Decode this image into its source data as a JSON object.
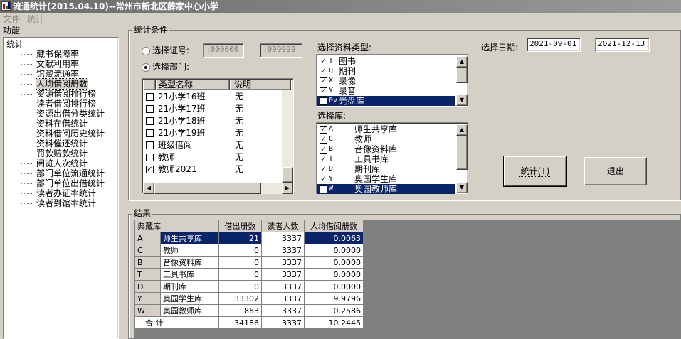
{
  "window": {
    "title": "流通统计(2015.04.10)--常州市新北区薛家中心小学"
  },
  "menu": [
    {
      "label": "文件"
    },
    {
      "label": "统计"
    }
  ],
  "function_panel": {
    "title": "功能",
    "root": "统计",
    "items": [
      "藏书保障率",
      "文献利用率",
      "馆藏流通率",
      "人均借阅册数",
      "资源借阅排行榜",
      "读者借阅排行榜",
      "资源出借分类统计",
      "资料在借统计",
      "资料借阅历史统计",
      "资料催还统计",
      "罚款赔款统计",
      "阅览人次统计",
      "部门单位流通统计",
      "部门单位出借统计",
      "读者办证率统计",
      "读者到馆率统计"
    ],
    "selected_index": 3
  },
  "criteria": {
    "title": "统计条件",
    "radio_card": "选择证号:",
    "card_from": "j000000",
    "card_to": "j999999",
    "dash": "—",
    "radio_dept": "选择部门:",
    "dept_columns": [
      "类型名称",
      "说明"
    ],
    "dept_rows": [
      {
        "name": "21小学16班",
        "desc": "无",
        "checked": false
      },
      {
        "name": "21小学17班",
        "desc": "无",
        "checked": false
      },
      {
        "name": "21小学18班",
        "desc": "无",
        "checked": false
      },
      {
        "name": "21小学19班",
        "desc": "无",
        "checked": false
      },
      {
        "name": "班级借阅",
        "desc": "无",
        "checked": false
      },
      {
        "name": "教师",
        "desc": "无",
        "checked": false
      },
      {
        "name": "教师2021",
        "desc": "无",
        "checked": true
      }
    ],
    "type_label": "选择资料类型:",
    "types": [
      {
        "code": "T",
        "name": "图书",
        "checked": true
      },
      {
        "code": "Q",
        "name": "期刊",
        "checked": true
      },
      {
        "code": "X",
        "name": "录像",
        "checked": true
      },
      {
        "code": "Y",
        "name": "录音",
        "checked": true
      },
      {
        "code": "0v",
        "name": "光盘库",
        "checked": true,
        "selected": true
      }
    ],
    "lib_label": "选择库:",
    "libs": [
      {
        "code": "A",
        "name": "师生共享库",
        "checked": true
      },
      {
        "code": "C",
        "name": "教师",
        "checked": true
      },
      {
        "code": "B",
        "name": "音像资料库",
        "checked": true
      },
      {
        "code": "T",
        "name": "工具书库",
        "checked": true
      },
      {
        "code": "D",
        "name": "期刊库",
        "checked": true
      },
      {
        "code": "Y",
        "name": "奥园学生库",
        "checked": true
      },
      {
        "code": "W",
        "name": "奥园教师库",
        "checked": true,
        "selected": true
      }
    ],
    "date_label": "选择日期:",
    "date_from": "2021-09-01",
    "date_to": "2021-12-13",
    "btn_stat": "统计(T)",
    "btn_exit": "退出"
  },
  "results": {
    "title": "结果",
    "columns": [
      "典藏库",
      "借出册数",
      "读者人数",
      "人均借阅册数"
    ],
    "rows": [
      {
        "code": "A",
        "name": "师生共享库",
        "lent": "21",
        "readers": "3337",
        "avg": "0.0063",
        "selected": true
      },
      {
        "code": "C",
        "name": "教师",
        "lent": "0",
        "readers": "3337",
        "avg": "0.0000"
      },
      {
        "code": "B",
        "name": "音像资料库",
        "lent": "0",
        "readers": "3337",
        "avg": "0.0000"
      },
      {
        "code": "T",
        "name": "工具书库",
        "lent": "0",
        "readers": "3337",
        "avg": "0.0000"
      },
      {
        "code": "D",
        "name": "期刊库",
        "lent": "0",
        "readers": "3337",
        "avg": "0.0000"
      },
      {
        "code": "Y",
        "name": "奥园学生库",
        "lent": "33302",
        "readers": "3337",
        "avg": "9.9796"
      },
      {
        "code": "W",
        "name": "奥园教师库",
        "lent": "863",
        "readers": "3337",
        "avg": "0.2586"
      }
    ],
    "total": {
      "label": "合 计",
      "lent": "34186",
      "readers": "3337",
      "avg": "10.2445"
    }
  },
  "colors": {
    "selection": "#0a246a",
    "face": "#d4d0c8",
    "grid_area": "#808080"
  }
}
